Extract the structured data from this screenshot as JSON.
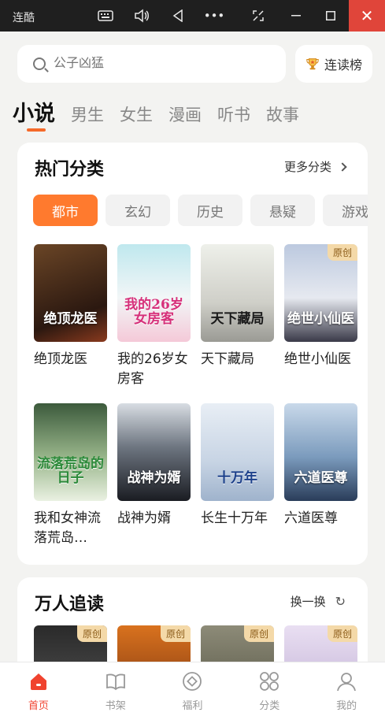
{
  "window": {
    "title": "连酷",
    "controls": [
      "keyboard-icon",
      "volume-icon",
      "back-icon",
      "more-icon",
      "screenshot-icon",
      "minimize-icon",
      "maximize-icon",
      "close-icon"
    ]
  },
  "search": {
    "placeholder": "公子凶猛"
  },
  "rank_button": {
    "label": "连读榜"
  },
  "tabs": [
    {
      "label": "小说"
    },
    {
      "label": "男生"
    },
    {
      "label": "女生"
    },
    {
      "label": "漫画"
    },
    {
      "label": "听书"
    },
    {
      "label": "故事"
    }
  ],
  "hot": {
    "title": "热门分类",
    "more_label": "更多分类",
    "categories": [
      {
        "label": "都市"
      },
      {
        "label": "玄幻"
      },
      {
        "label": "历史"
      },
      {
        "label": "悬疑"
      },
      {
        "label": "游戏"
      }
    ],
    "books": [
      {
        "title": "绝顶龙医",
        "cover_text": "绝顶龙医",
        "badge": ""
      },
      {
        "title": "我的26岁女房客",
        "cover_text": "我的26岁女房客",
        "badge": ""
      },
      {
        "title": "天下藏局",
        "cover_text": "天下藏局",
        "badge": ""
      },
      {
        "title": "绝世小仙医",
        "cover_text": "绝世小仙医",
        "badge": "原创"
      },
      {
        "title": "我和女神流落荒岛…",
        "cover_text": "流落荒岛的日子",
        "badge": ""
      },
      {
        "title": "战神为婿",
        "cover_text": "战神为婿",
        "badge": ""
      },
      {
        "title": "长生十万年",
        "cover_text": "十万年",
        "badge": ""
      },
      {
        "title": "六道医尊",
        "cover_text": "六道医尊",
        "badge": ""
      }
    ]
  },
  "popular": {
    "title": "万人追读",
    "refresh_label": "换一换",
    "books": [
      {
        "badge": "原创"
      },
      {
        "badge": "原创"
      },
      {
        "badge": "原创"
      },
      {
        "badge": "原创"
      }
    ]
  },
  "bottom_nav": [
    {
      "label": "首页",
      "icon": "home-icon"
    },
    {
      "label": "书架",
      "icon": "bookshelf-icon"
    },
    {
      "label": "福利",
      "icon": "welfare-icon"
    },
    {
      "label": "分类",
      "icon": "category-icon"
    },
    {
      "label": "我的",
      "icon": "profile-icon"
    }
  ],
  "colors": {
    "accent": "#ff7a2e",
    "nav_active": "#f0432f",
    "close": "#e0453a"
  }
}
